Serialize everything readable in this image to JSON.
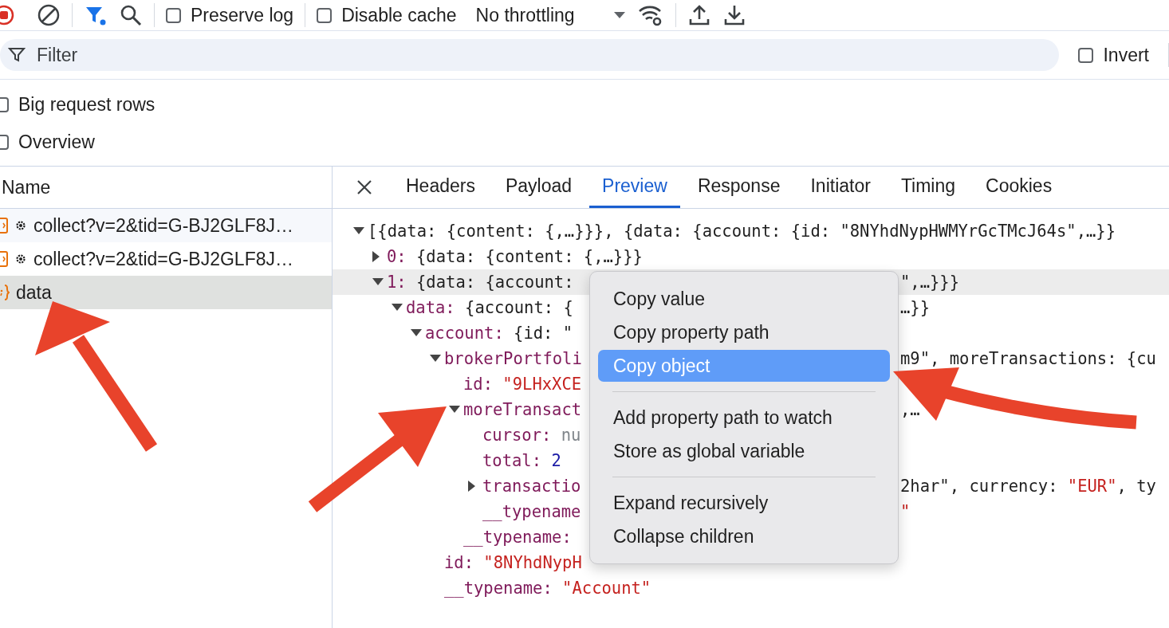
{
  "toolbar": {
    "preserve_log": {
      "label": "Preserve log",
      "checked": false
    },
    "disable_cache": {
      "label": "Disable cache",
      "checked": false
    },
    "throttling": "No throttling"
  },
  "filter": {
    "placeholder": "Filter",
    "invert": {
      "label": "Invert",
      "checked": false
    }
  },
  "options": [
    {
      "label": "Big request rows",
      "checked": false
    },
    {
      "label": "Overview",
      "checked": false
    }
  ],
  "requests": {
    "column": "Name",
    "rows": [
      {
        "name": "collect?v=2&tid=G-BJ2GLF8J…",
        "kind": "ping",
        "selected": false
      },
      {
        "name": "collect?v=2&tid=G-BJ2GLF8J…",
        "kind": "ping",
        "selected": false
      },
      {
        "name": "data",
        "kind": "fetch",
        "selected": true
      }
    ]
  },
  "details": {
    "tabs": [
      {
        "label": "Headers",
        "selected": false
      },
      {
        "label": "Payload",
        "selected": false
      },
      {
        "label": "Preview",
        "selected": true
      },
      {
        "label": "Response",
        "selected": false
      },
      {
        "label": "Initiator",
        "selected": false
      },
      {
        "label": "Timing",
        "selected": false
      },
      {
        "label": "Cookies",
        "selected": false
      }
    ],
    "tree": [
      {
        "value": "[{data: {content: {,…}}}, {data: {account: {id: \"8NYhdNypHWMYrGcTMcJ64s\",…}}",
        "kind": "object",
        "expanded": true,
        "selected": false,
        "children": [
          {
            "key": "0:",
            "value": "{data: {content: {,…}}}",
            "kind": "object",
            "expanded": false,
            "selected": false
          },
          {
            "key": "1:",
            "value": "{data: {account: ",
            "kind": "object",
            "right": [
              {
                "text": "\",…}}}",
                "kind": "object"
              }
            ],
            "expanded": true,
            "selected": true,
            "children": [
              {
                "key": "data:",
                "value": "{account: {",
                "kind": "object",
                "right": [
                  {
                    "text": "…}}",
                    "kind": "object"
                  }
                ],
                "expanded": true,
                "selected": false,
                "children": [
                  {
                    "key": "account:",
                    "value": "{id: \"",
                    "kind": "object",
                    "expanded": true,
                    "selected": false,
                    "children": [
                      {
                        "key": "brokerPortfoli",
                        "right": [
                          {
                            "text": "m9\", moreTransactions: {cu",
                            "kind": "object"
                          }
                        ],
                        "expanded": true,
                        "selected": false,
                        "children": [
                          {
                            "key": "id:",
                            "value": "\"9LHxXCE",
                            "kind": "string",
                            "selected": false
                          },
                          {
                            "key": "moreTransact",
                            "right": [
                              {
                                "text": ",…",
                                "kind": "object"
                              }
                            ],
                            "expanded": true,
                            "selected": false,
                            "children": [
                              {
                                "key": "cursor:",
                                "value": "nu",
                                "kind": "null",
                                "selected": false
                              },
                              {
                                "key": "total:",
                                "value": "2",
                                "kind": "number",
                                "selected": false
                              },
                              {
                                "key": "transactio",
                                "right": [
                                  {
                                    "text": "2har\", currency: ",
                                    "kind": "object"
                                  },
                                  {
                                    "text": "\"EUR\"",
                                    "kind": "string"
                                  },
                                  {
                                    "text": ", ty",
                                    "kind": "object"
                                  }
                                ],
                                "expanded": false,
                                "selected": false
                              },
                              {
                                "key": "__typename",
                                "right": [
                                  {
                                    "text": "\"",
                                    "kind": "string"
                                  }
                                ],
                                "selected": false
                              }
                            ]
                          },
                          {
                            "key": "__typename:",
                            "selected": false
                          }
                        ]
                      },
                      {
                        "key": "id:",
                        "value": "\"8NYhdNypH",
                        "kind": "string",
                        "selected": false
                      },
                      {
                        "key": "__typename:",
                        "value": "\"Account\"",
                        "kind": "string",
                        "selected": false
                      }
                    ]
                  }
                ]
              }
            ]
          }
        ]
      }
    ]
  },
  "context_menu": [
    {
      "kind": "item",
      "label": "Copy value",
      "selected": false
    },
    {
      "kind": "item",
      "label": "Copy property path",
      "selected": false
    },
    {
      "kind": "item",
      "label": "Copy object",
      "selected": true
    },
    {
      "kind": "separator"
    },
    {
      "kind": "item",
      "label": "Add property path to watch",
      "selected": false
    },
    {
      "kind": "item",
      "label": "Store as global variable",
      "selected": false
    },
    {
      "kind": "separator"
    },
    {
      "kind": "item",
      "label": "Expand recursively",
      "selected": false
    },
    {
      "kind": "item",
      "label": "Collapse children",
      "selected": false
    }
  ]
}
